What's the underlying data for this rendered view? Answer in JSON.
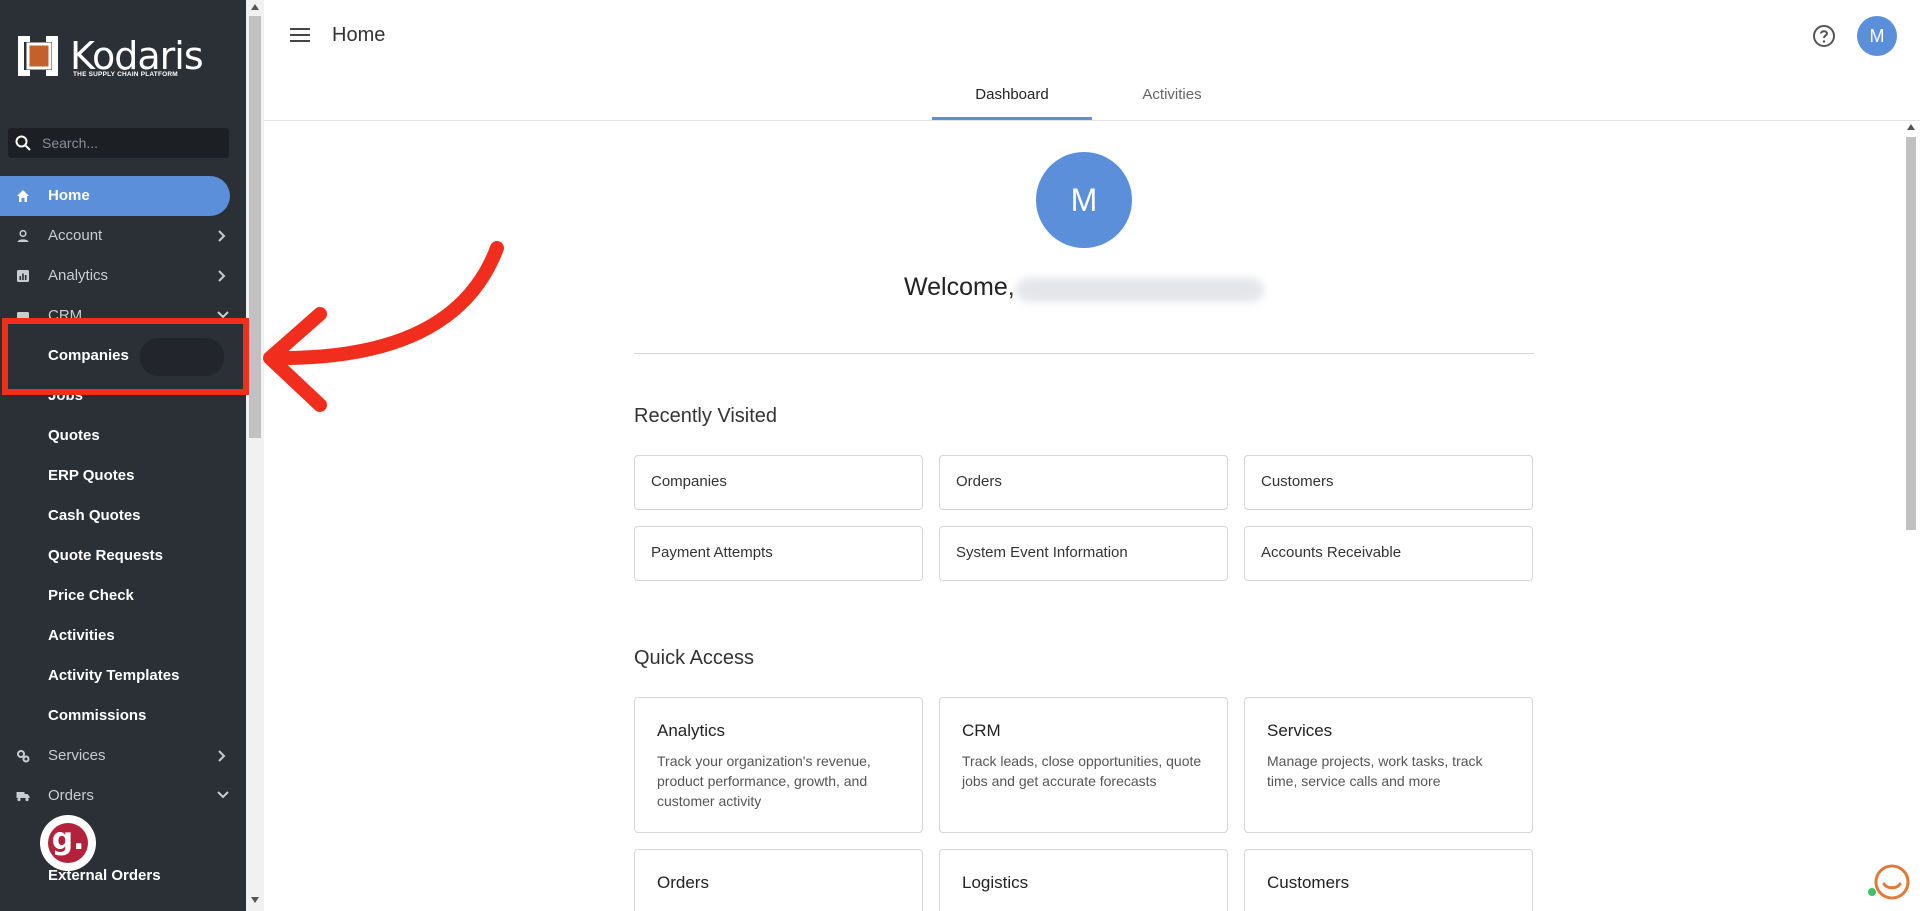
{
  "sidebar": {
    "logo_text": "Kodaris",
    "logo_tagline": "THE SUPPLY CHAIN PLATFORM",
    "search_placeholder": "Search...",
    "nav": [
      {
        "label": "Home",
        "icon": "home-icon",
        "active": true
      },
      {
        "label": "Account",
        "icon": "user-icon",
        "chevron": "right"
      },
      {
        "label": "Analytics",
        "icon": "analytics-icon",
        "chevron": "right"
      },
      {
        "label": "CRM",
        "icon": "crm-icon",
        "chevron": "down"
      }
    ],
    "crm_items": [
      "Companies",
      "Jobs",
      "Quotes",
      "ERP Quotes",
      "Cash Quotes",
      "Quote Requests",
      "Price Check",
      "Activities",
      "Activity Templates",
      "Commissions"
    ],
    "nav_after": [
      {
        "label": "Services",
        "icon": "services-icon",
        "chevron": "right"
      },
      {
        "label": "Orders",
        "icon": "truck-icon",
        "chevron": "down"
      }
    ],
    "orders_items": [
      "External Orders"
    ]
  },
  "header": {
    "title": "Home",
    "avatar_initial": "M",
    "tabs": [
      {
        "label": "Dashboard",
        "active": true
      },
      {
        "label": "Activities",
        "active": false
      }
    ]
  },
  "main": {
    "avatar_initial": "M",
    "welcome": "Welcome,",
    "recently_visited_title": "Recently Visited",
    "recently_visited": [
      "Companies",
      "Orders",
      "Customers",
      "Payment Attempts",
      "System Event Information",
      "Accounts Receivable"
    ],
    "quick_access_title": "Quick Access",
    "quick_access": [
      {
        "title": "Analytics",
        "desc": "Track your organization's revenue, product performance, growth, and customer activity"
      },
      {
        "title": "CRM",
        "desc": "Track leads, close opportunities, quote jobs and get accurate forecasts"
      },
      {
        "title": "Services",
        "desc": "Manage projects, work tasks, track time, service calls and more"
      },
      {
        "title": "Orders",
        "desc": ""
      },
      {
        "title": "Logistics",
        "desc": ""
      },
      {
        "title": "Customers",
        "desc": ""
      }
    ]
  },
  "colors": {
    "sidebar_bg": "#2b2f36",
    "accent": "#5b8fd9",
    "highlight": "#f12d1e"
  }
}
